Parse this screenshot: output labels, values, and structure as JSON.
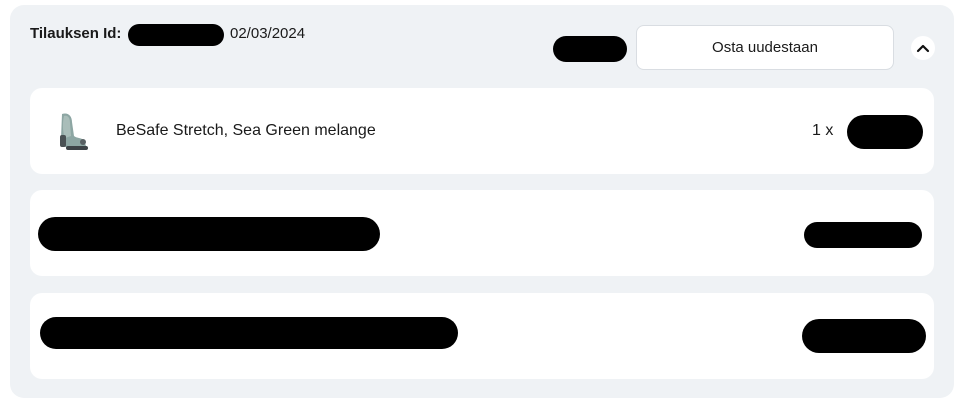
{
  "order": {
    "id_label": "Tilauksen Id:",
    "date": "02/03/2024",
    "buy_again_label": "Osta uudestaan",
    "collapse_icon": "chevron-up-icon"
  },
  "items": [
    {
      "name": "BeSafe Stretch, Sea Green melange",
      "quantity": "1 x",
      "thumbnail": "car-seat-image"
    }
  ],
  "colors": {
    "card_background": "#eff2f5",
    "row_background": "#ffffff",
    "redaction": "#000000"
  }
}
